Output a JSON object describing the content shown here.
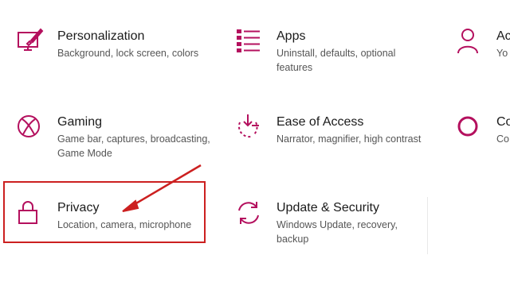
{
  "accent_color": "#b4105e",
  "annotation_color": "#cc2020",
  "tiles": [
    {
      "id": "personalization",
      "title": "Personalization",
      "desc": "Background, lock screen, colors",
      "icon": "personalization-icon"
    },
    {
      "id": "apps",
      "title": "Apps",
      "desc": "Uninstall, defaults, optional features",
      "icon": "apps-list-icon"
    },
    {
      "id": "accounts",
      "title": "Ac",
      "desc": "Yo",
      "icon": "person-icon"
    },
    {
      "id": "gaming",
      "title": "Gaming",
      "desc": "Game bar, captures, broadcasting, Game Mode",
      "icon": "xbox-icon"
    },
    {
      "id": "ease",
      "title": "Ease of Access",
      "desc": "Narrator, magnifier, high contrast",
      "icon": "ease-of-access-icon"
    },
    {
      "id": "cortana",
      "title": "Co",
      "desc": "Co",
      "icon": "cortana-circle-icon"
    },
    {
      "id": "privacy",
      "title": "Privacy",
      "desc": "Location, camera, microphone",
      "icon": "lock-icon"
    },
    {
      "id": "update",
      "title": "Update & Security",
      "desc": "Windows Update, recovery, backup",
      "icon": "sync-arrows-icon"
    }
  ]
}
